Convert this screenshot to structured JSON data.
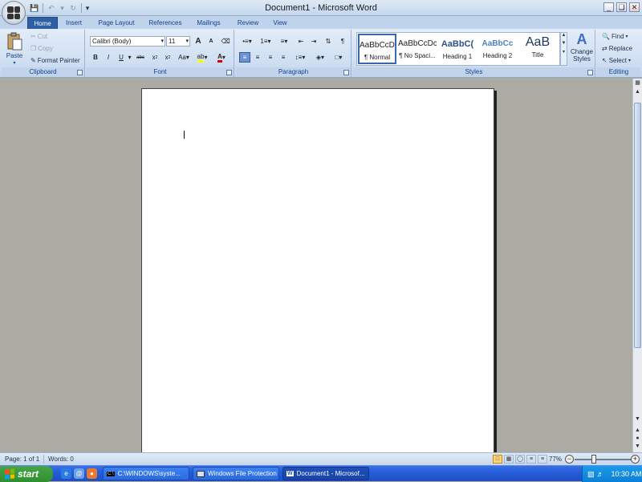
{
  "window": {
    "title": "Document1 - Microsoft Word",
    "minimize": "_",
    "restore": "❏",
    "close": "✕"
  },
  "tabs": [
    "Home",
    "Insert",
    "Page Layout",
    "References",
    "Mailings",
    "Review",
    "View"
  ],
  "clipboard": {
    "paste": "Paste",
    "cut": "Cut",
    "copy": "Copy",
    "format_painter": "Format Painter",
    "label": "Clipboard"
  },
  "font": {
    "name": "Calibri (Body)",
    "size": "11",
    "label": "Font"
  },
  "paragraph": {
    "label": "Paragraph"
  },
  "styles": {
    "items": [
      {
        "preview": "AaBbCcDc",
        "name": "¶ Normal"
      },
      {
        "preview": "AaBbCcDc",
        "name": "¶ No Spaci..."
      },
      {
        "preview": "AaBbC(",
        "name": "Heading 1"
      },
      {
        "preview": "AaBbCc",
        "name": "Heading 2"
      },
      {
        "preview": "AaB",
        "name": "Title"
      }
    ],
    "change_styles": "Change Styles",
    "label": "Styles"
  },
  "editing": {
    "find": "Find",
    "replace": "Replace",
    "select": "Select",
    "label": "Editing"
  },
  "status": {
    "page": "Page: 1 of 1",
    "words": "Words: 0",
    "zoom": "77%"
  },
  "taskbar": {
    "start": "start",
    "buttons": [
      "C:\\WINDOWS\\syste...",
      "Windows File Protection",
      "Document1 - Microsof..."
    ],
    "clock": "10:30 AM"
  }
}
